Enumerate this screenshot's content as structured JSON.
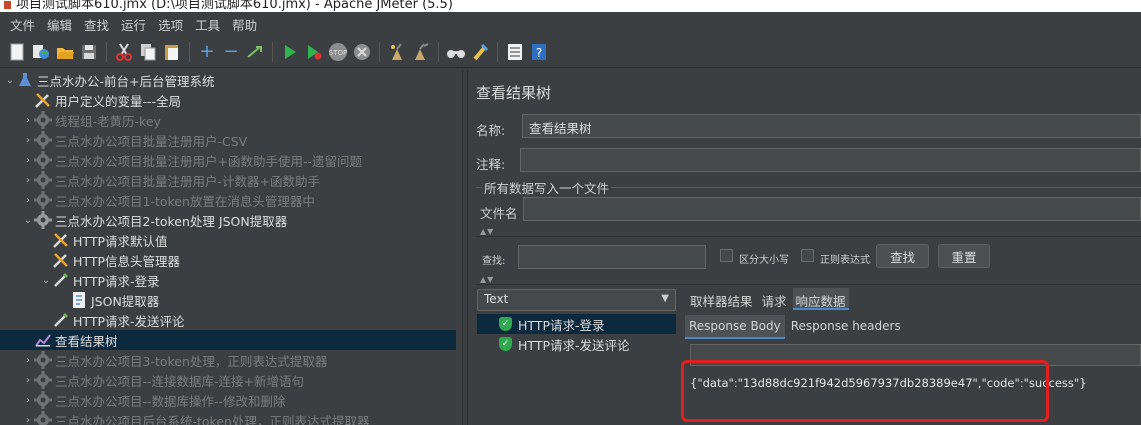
{
  "window": {
    "title": "项目测试脚本610.jmx (D:\\项目测试脚本610.jmx) - Apache JMeter (5.5)"
  },
  "menu": [
    "文件",
    "编辑",
    "查找",
    "运行",
    "选项",
    "工具",
    "帮助"
  ],
  "toolbar": [
    "new-icon",
    "templates-icon",
    "open-icon",
    "save-icon",
    "cut-icon",
    "copy-icon",
    "paste-icon",
    "expand-icon",
    "collapse-icon",
    "toggle-icon",
    "start-icon",
    "start-no-pause-icon",
    "stop-icon",
    "shutdown-icon",
    "clear-icon",
    "clear-all-icon",
    "search-icon",
    "reset-search-icon",
    "function-helper-icon",
    "help-icon"
  ],
  "tree": [
    {
      "label": "三点水办公-前台+后台管理系统",
      "icon": "flask-icon",
      "arrow": "expanded",
      "indent": 0,
      "enabled": true
    },
    {
      "label": "用户定义的变量---全局",
      "icon": "wrench-icon",
      "arrow": "none",
      "indent": 1,
      "enabled": true
    },
    {
      "label": "线程组-老黄历-key",
      "icon": "gear-icon",
      "arrow": "collapsed",
      "indent": 1,
      "enabled": false
    },
    {
      "label": "三点水办公项目批量注册用户-CSV",
      "icon": "gear-icon",
      "arrow": "collapsed",
      "indent": 1,
      "enabled": false
    },
    {
      "label": "三点水办公项目批量注册用户+函数助手使用--遗留问题",
      "icon": "gear-icon",
      "arrow": "collapsed",
      "indent": 1,
      "enabled": false
    },
    {
      "label": "三点水办公项目批量注册用户-计数器+函数助手",
      "icon": "gear-icon",
      "arrow": "collapsed",
      "indent": 1,
      "enabled": false
    },
    {
      "label": "三点水办公项目1-token放置在消息头管理器中",
      "icon": "gear-icon",
      "arrow": "collapsed",
      "indent": 1,
      "enabled": false
    },
    {
      "label": "三点水办公项目2-token处理 JSON提取器",
      "icon": "gear-icon",
      "arrow": "expanded",
      "indent": 1,
      "enabled": true
    },
    {
      "label": "HTTP请求默认值",
      "icon": "wrench-icon",
      "arrow": "none",
      "indent": 2,
      "enabled": true
    },
    {
      "label": "HTTP信息头管理器",
      "icon": "wrench-icon",
      "arrow": "none",
      "indent": 2,
      "enabled": true
    },
    {
      "label": "HTTP请求-登录",
      "icon": "pipette-icon",
      "arrow": "expanded",
      "indent": 2,
      "enabled": true
    },
    {
      "label": "JSON提取器",
      "icon": "document-icon",
      "arrow": "none",
      "indent": 3,
      "enabled": true
    },
    {
      "label": "HTTP请求-发送评论",
      "icon": "pipette-icon",
      "arrow": "none",
      "indent": 2,
      "enabled": true
    },
    {
      "label": "查看结果树",
      "icon": "chart-icon",
      "arrow": "none",
      "indent": 1,
      "enabled": true,
      "selected": true
    },
    {
      "label": "三点水办公项目3-token处理，正则表达式提取器",
      "icon": "gear-icon",
      "arrow": "collapsed",
      "indent": 1,
      "enabled": false
    },
    {
      "label": "三点水办公项目--连接数据库-连接+新增语句",
      "icon": "gear-icon",
      "arrow": "collapsed",
      "indent": 1,
      "enabled": false
    },
    {
      "label": "三点水办公项目--数据库操作--修改和删除",
      "icon": "gear-icon",
      "arrow": "collapsed",
      "indent": 1,
      "enabled": false
    },
    {
      "label": "三点水办公项目后台系统-token处理，正则表达式提取器",
      "icon": "gear-icon",
      "arrow": "collapsed",
      "indent": 1,
      "enabled": false
    }
  ],
  "panel": {
    "title": "查看结果树",
    "name_label": "名称:",
    "name_value": "查看结果树",
    "comment_label": "注释:",
    "comment_value": "",
    "file_group_title": "所有数据写入一个文件",
    "filename_label": "文件名",
    "filename_value": "",
    "search_label": "查找:",
    "search_value": "",
    "case_sensitive_label": "区分大小写",
    "regex_label": "正则表达式",
    "search_button": "查找",
    "reset_button": "重置"
  },
  "results": {
    "renderer": "Text",
    "items": [
      "HTTP请求-登录",
      "HTTP请求-发送评论"
    ],
    "selected_index": 0
  },
  "detail_tabs": [
    "取样器结果",
    "请求",
    "响应数据"
  ],
  "active_detail_tab": 2,
  "response_tabs": [
    "Response Body",
    "Response headers"
  ],
  "active_response_tab": 0,
  "response_body": "{\"data\":\"13d88dc921f942d5967937db28389e47\",\"code\":\"success\"}",
  "colors": {
    "background": "#3c3f41",
    "selection": "#0d293e",
    "highlight_box": "#e02020",
    "ok_shield": "#2fa84f"
  }
}
